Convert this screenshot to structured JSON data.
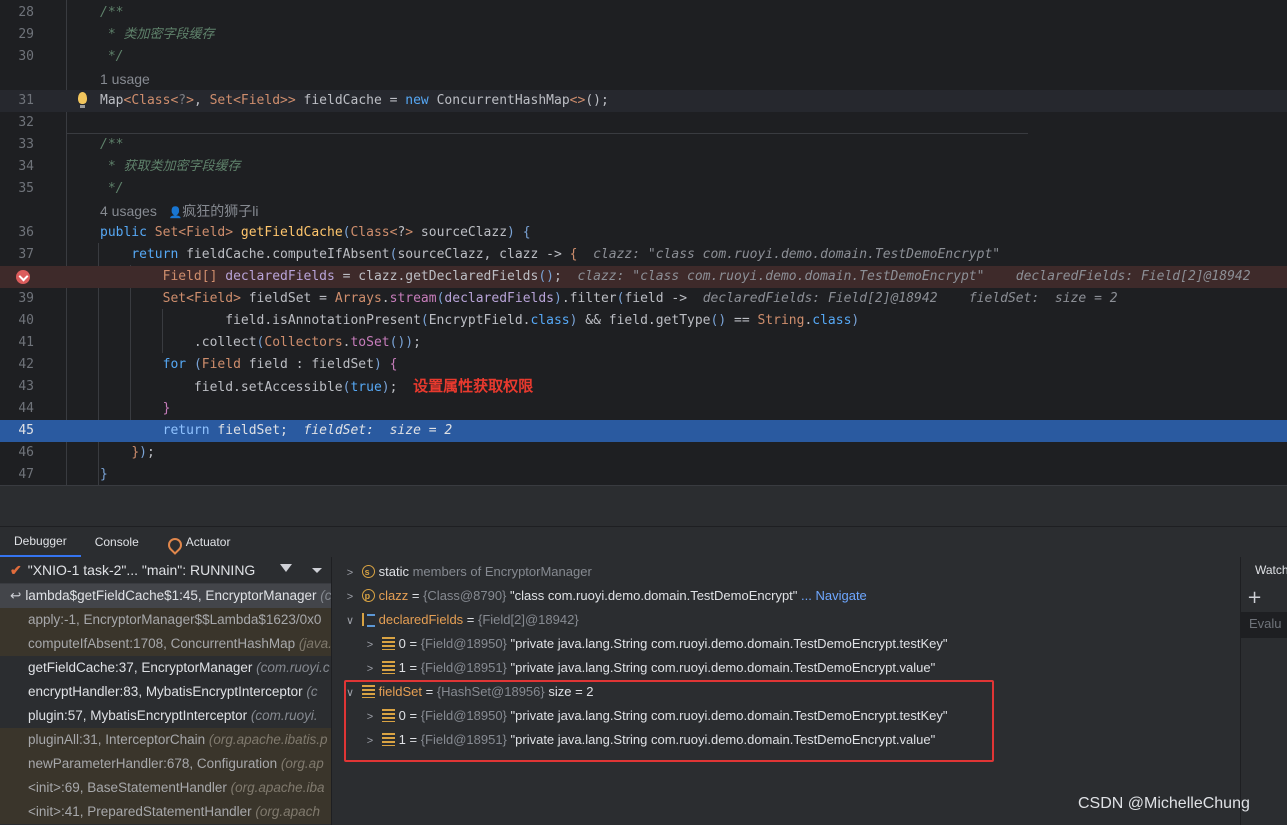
{
  "editor": {
    "lines": [
      {
        "num": "28",
        "text": "/**"
      },
      {
        "num": "29",
        "text": " * 类加密字段缓存"
      },
      {
        "num": "30",
        "text": " */"
      },
      {
        "hint": "1 usage"
      },
      {
        "num": "31"
      },
      {
        "num": "32"
      },
      {
        "num": "33",
        "text": "/**"
      },
      {
        "num": "34",
        "text": " * 获取类加密字段缓存"
      },
      {
        "num": "35",
        "text": " */"
      },
      {
        "hint": "4 usages",
        "author": "疯狂的狮子li"
      },
      {
        "num": "36"
      },
      {
        "num": "37"
      },
      {
        "num": "38"
      },
      {
        "num": "39"
      },
      {
        "num": "40"
      },
      {
        "num": "41"
      },
      {
        "num": "42"
      },
      {
        "num": "43",
        "note": "设置属性获取权限"
      },
      {
        "num": "44"
      },
      {
        "num": "45"
      },
      {
        "num": "46"
      },
      {
        "num": "47"
      }
    ],
    "inlays": {
      "l37": "clazz: \"class com.ruoyi.demo.domain.TestDemoEncrypt\"",
      "l38": "clazz: \"class com.ruoyi.demo.domain.TestDemoEncrypt\"    declaredFields: Field[2]@18942",
      "l39": "declaredFields: Field[2]@18942    fieldSet:  size = 2",
      "l45": "fieldSet:  size = 2"
    }
  },
  "debugger": {
    "tabs": [
      "Debugger",
      "Console",
      "Actuator"
    ],
    "thread": "\"XNIO-1 task-2\"... \"main\": RUNNING",
    "frames": [
      {
        "method": "lambda$getFieldCache$1:45, EncryptorManager",
        "pkg": "(com.ruoyi"
      },
      {
        "method": "apply:-1, EncryptorManager$$Lambda$1623/0x0",
        "pkg": ""
      },
      {
        "method": "computeIfAbsent:1708, ConcurrentHashMap",
        "pkg": "(java.util"
      },
      {
        "method": "getFieldCache:37, EncryptorManager",
        "pkg": "(com.ruoyi.c"
      },
      {
        "method": "encryptHandler:83, MybatisEncryptInterceptor",
        "pkg": "(c"
      },
      {
        "method": "plugin:57, MybatisEncryptInterceptor",
        "pkg": "(com.ruoyi."
      },
      {
        "method": "pluginAll:31, InterceptorChain",
        "pkg": "(org.apache.ibatis.p"
      },
      {
        "method": "newParameterHandler:678, Configuration",
        "pkg": "(org.ap"
      },
      {
        "method": "<init>:69, BaseStatementHandler",
        "pkg": "(org.apache.iba"
      },
      {
        "method": "<init>:41, PreparedStatementHandler",
        "pkg": "(org.apach"
      }
    ],
    "variables": {
      "static": {
        "name": "static",
        "rest": "members of EncryptorManager"
      },
      "clazz": {
        "name": "clazz",
        "type": "{Class@8790}",
        "value": "\"class com.ruoyi.demo.domain.TestDemoEncrypt\"",
        "link": "... Navigate"
      },
      "declaredFields": {
        "name": "declaredFields",
        "type": "{Field[2]@18942}"
      },
      "df0": {
        "name": "0",
        "type": "{Field@18950}",
        "value": "\"private java.lang.String com.ruoyi.demo.domain.TestDemoEncrypt.testKey\""
      },
      "df1": {
        "name": "1",
        "type": "{Field@18951}",
        "value": "\"private java.lang.String com.ruoyi.demo.domain.TestDemoEncrypt.value\""
      },
      "fieldSet": {
        "name": "fieldSet",
        "type": "{HashSet@18956}",
        "value": "size = 2"
      },
      "fs0": {
        "name": "0",
        "type": "{Field@18950}",
        "value": "\"private java.lang.String com.ruoyi.demo.domain.TestDemoEncrypt.testKey\""
      },
      "fs1": {
        "name": "1",
        "type": "{Field@18951}",
        "value": "\"private java.lang.String com.ruoyi.demo.domain.TestDemoEncrypt.value\""
      }
    },
    "watches": {
      "title": "Watch",
      "placeholder": "Evalu"
    }
  },
  "watermark": "CSDN @MichelleChung"
}
